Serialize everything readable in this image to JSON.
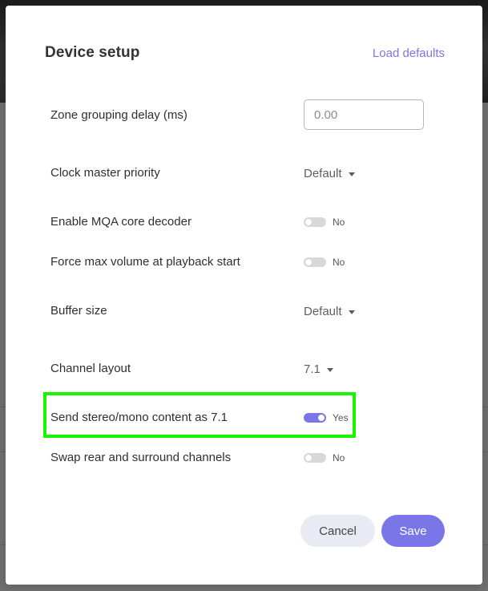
{
  "modal": {
    "title": "Device setup",
    "load_defaults": "Load defaults"
  },
  "settings": {
    "zone_grouping_delay": {
      "label": "Zone grouping delay (ms)",
      "placeholder": "0.00"
    },
    "clock_master_priority": {
      "label": "Clock master priority",
      "value": "Default"
    },
    "enable_mqa_core_decoder": {
      "label": "Enable MQA core decoder",
      "state": "No"
    },
    "force_max_volume": {
      "label": "Force max volume at playback start",
      "state": "No"
    },
    "buffer_size": {
      "label": "Buffer size",
      "value": "Default"
    },
    "channel_layout": {
      "label": "Channel layout",
      "value": "7.1"
    },
    "send_stereo_mono_as_71": {
      "label": "Send stereo/mono content as 7.1",
      "state": "Yes"
    },
    "swap_rear_surround": {
      "label": "Swap rear and surround channels",
      "state": "No"
    }
  },
  "actions": {
    "cancel": "Cancel",
    "save": "Save"
  },
  "colors": {
    "accent": "#7a76e8",
    "highlight": "#17f500",
    "toggle_off": "#d8d8d8",
    "cancel_bg": "#e8ebf3"
  },
  "icons": {
    "dropdown": "chevron-down-icon"
  }
}
